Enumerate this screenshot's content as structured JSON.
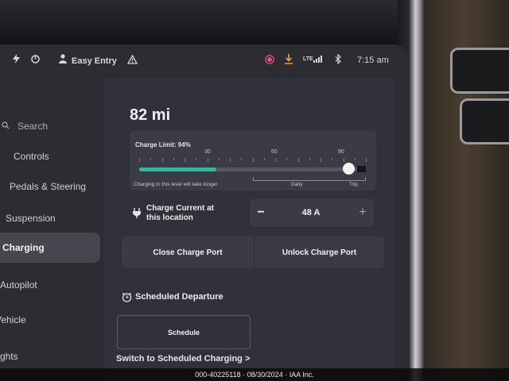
{
  "status_bar": {
    "profile": "Easy Entry",
    "lte": "LTE",
    "time": "7:15 am"
  },
  "sidebar": {
    "items": [
      {
        "label": "Search"
      },
      {
        "label": "Controls"
      },
      {
        "label": "Pedals & Steering"
      },
      {
        "label": "Suspension"
      },
      {
        "label": "Charging"
      },
      {
        "label": "Autopilot"
      },
      {
        "label": "Vehicle"
      },
      {
        "label": "ghts"
      }
    ],
    "active_index": 4
  },
  "charging": {
    "range": "82 mi",
    "charge_limit_label": "Charge Limit: 94%",
    "charge_limit_percent": 94,
    "current_charge_percent": 34,
    "ticks": [
      "30",
      "60",
      "90"
    ],
    "hint": "Charging to this level will take longer",
    "daily_label": "Daily",
    "trip_label": "Trip",
    "current_title_line1": "Charge Current at",
    "current_title_line2": "this location",
    "current_value": "48 A",
    "minus": "−",
    "plus": "+",
    "close_port": "Close Charge Port",
    "unlock_port": "Unlock Charge Port",
    "scheduled_departure": "Scheduled Departure",
    "schedule_button": "Schedule",
    "switch_link": "Switch to Scheduled Charging >"
  },
  "footer": {
    "text": "000-40225118 · 08/30/2024 · IAA Inc."
  },
  "colors": {
    "accent": "#1fc1a2",
    "screen": "#2c2d33",
    "card": "#3a3b44"
  }
}
